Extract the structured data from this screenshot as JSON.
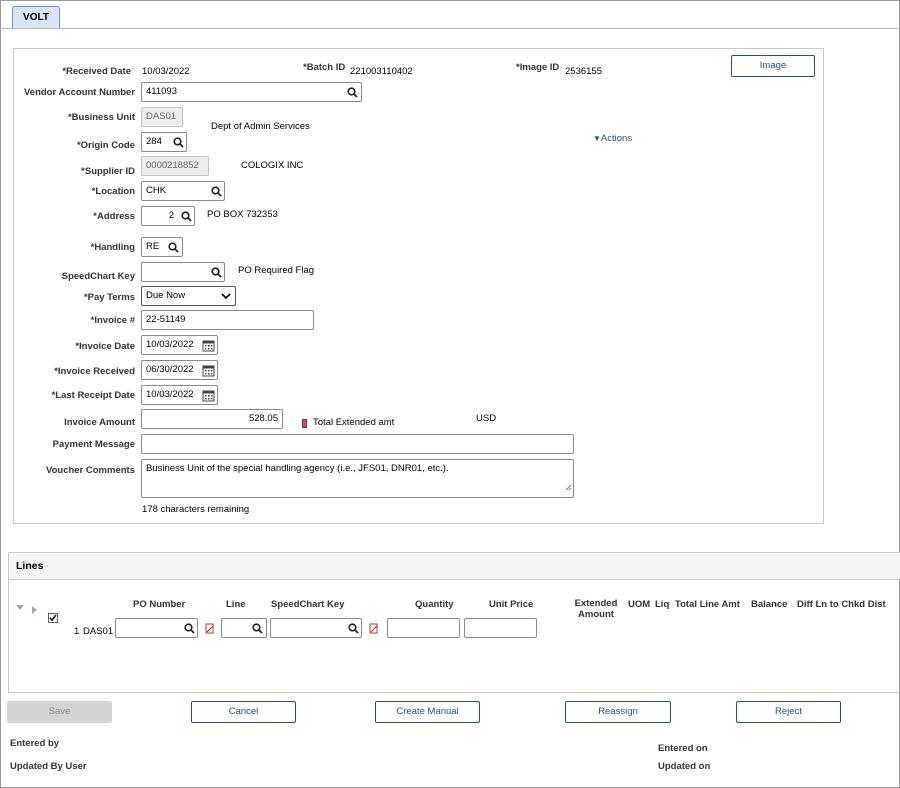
{
  "tab": {
    "label": "VOLT"
  },
  "header": {
    "received_date_label": "*Received Date",
    "received_date": "10/03/2022",
    "batch_id_label": "*Batch ID",
    "batch_id": "221003110402",
    "image_id_label": "*Image ID",
    "image_id": "2536155",
    "image_button": "Image"
  },
  "form": {
    "vendor_account_number_label": "Vendor Account Number",
    "vendor_account_number": "411093",
    "business_unit_label": "*Business Unit",
    "business_unit": "DAS01",
    "business_unit_desc": "Dept of Admin Services",
    "origin_code_label": "*Origin Code",
    "origin_code": "284",
    "actions_link": "Actions",
    "supplier_id_label": "*Supplier ID",
    "supplier_id": "0000218852",
    "supplier_name": "COLOGIX INC",
    "location_label": "*Location",
    "location": "CHK",
    "address_label": "*Address",
    "address": "2",
    "address_desc": "PO BOX 732353",
    "handling_label": "*Handling",
    "handling": "RE",
    "speedchart_key_label": "SpeedChart Key",
    "speedchart_key": "",
    "po_required_flag": "PO Required Flag",
    "pay_terms_label": "*Pay Terms",
    "pay_terms": "Due Now",
    "invoice_no_label": "*Invoice #",
    "invoice_no": "22-51149",
    "invoice_date_label": "*Invoice Date",
    "invoice_date": "10/03/2022",
    "invoice_received_label": "*Invoice Received",
    "invoice_received": "06/30/2022",
    "last_receipt_date_label": "*Last Receipt Date",
    "last_receipt_date": "10/03/2022",
    "invoice_amount_label": "Invoice Amount",
    "invoice_amount": "528.05",
    "total_extended_amt": "Total Extended amt",
    "currency": "USD",
    "payment_message_label": "Payment Message",
    "payment_message": "",
    "voucher_comments_label": "Voucher Comments",
    "voucher_comments": "Business Unit of the special handling agency (i.e., JFS01, DNR01, etc.).",
    "chars_remaining": "178 characters remaining"
  },
  "lines": {
    "title": "Lines",
    "columns": {
      "po_number": "PO Number",
      "line": "Line",
      "speedchart_key": "SpeedChart Key",
      "quantity": "Quantity",
      "unit_price": "Unit Price",
      "extended_amount_1": "Extended",
      "extended_amount_2": "Amount",
      "uom": "UOM",
      "liq": "Liq",
      "total_line_amt": "Total Line Amt",
      "balance": "Balance",
      "diff_ln": "Diff Ln to Chkd Dist"
    },
    "row": {
      "line_no": "1",
      "business_unit": "DAS01",
      "po_number": "",
      "line": "",
      "speedchart_key": "",
      "quantity": "",
      "unit_price": ""
    }
  },
  "buttons": {
    "save": "Save",
    "cancel": "Cancel",
    "create_manual": "Create Manual",
    "reassign": "Reassign",
    "reject": "Reject"
  },
  "footer": {
    "entered_by_label": "Entered by",
    "updated_by_label": "Updated By User",
    "entered_on_label": "Entered on",
    "updated_on_label": "Updated on"
  },
  "colors": {
    "accent": "#1f4d91",
    "tab_bg": "#d8e6f7",
    "section_border": "#c8c8c8"
  }
}
